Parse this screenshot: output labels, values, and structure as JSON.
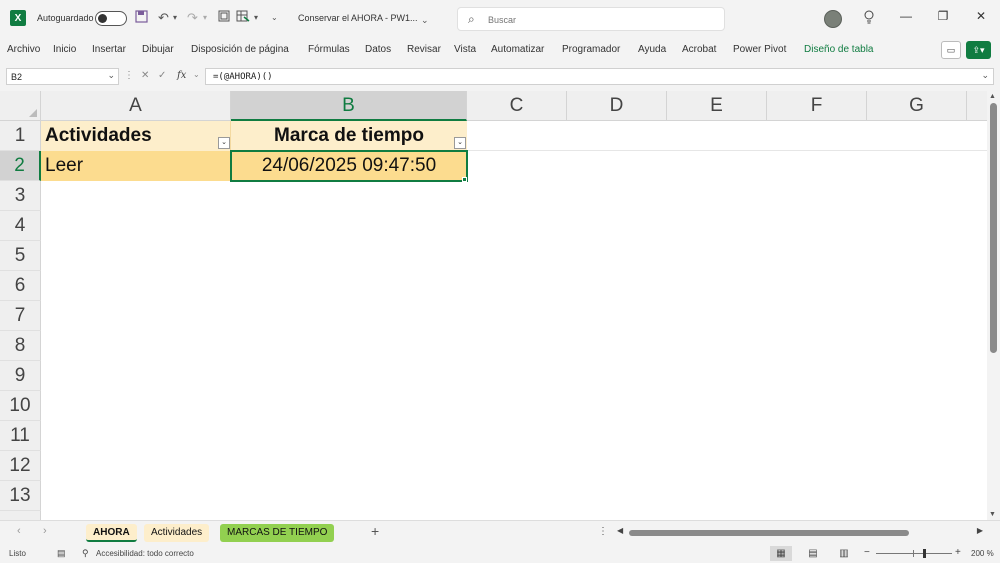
{
  "titlebar": {
    "autosave_label": "Autoguardado",
    "document_title": "Conservar el AHORA - PW1...",
    "search_placeholder": "Buscar"
  },
  "ribbon": {
    "tabs": [
      "Archivo",
      "Inicio",
      "Insertar",
      "Dibujar",
      "Disposición de página",
      "Fórmulas",
      "Datos",
      "Revisar",
      "Vista",
      "Automatizar",
      "Programador",
      "Ayuda",
      "Acrobat",
      "Power Pivot",
      "Diseño de tabla"
    ]
  },
  "formula_bar": {
    "name_box": "B2",
    "formula": "=(@AHORA)()"
  },
  "grid": {
    "columns": [
      "A",
      "B",
      "C",
      "D",
      "E",
      "F",
      "G"
    ],
    "rows": [
      "1",
      "2",
      "3",
      "4",
      "5",
      "6",
      "7",
      "8",
      "9",
      "10",
      "11",
      "12",
      "13"
    ],
    "selected_column": "B",
    "selected_row": "2",
    "table": {
      "headers": [
        "Actividades",
        "Marca de tiempo"
      ],
      "row1": [
        "Leer",
        "24/06/2025 09:47:50"
      ]
    }
  },
  "sheets": {
    "tabs": [
      "AHORA",
      "Actividades",
      "MARCAS DE TIEMPO"
    ],
    "active": "AHORA"
  },
  "status": {
    "ready": "Listo",
    "accessibility": "Accesibilidad: todo correcto",
    "zoom": "200 %"
  },
  "colors": {
    "accent": "#107c41",
    "table_header_fill": "#fdeecb",
    "table_row_fill": "#fcdc8f",
    "tab_green": "#92d050"
  },
  "icons": [
    "excel-logo-icon",
    "save-icon",
    "undo-icon",
    "redo-icon",
    "search-icon",
    "lightbulb-icon",
    "minimize-icon",
    "restore-icon",
    "close-icon",
    "comment-icon",
    "share-icon",
    "fx-icon",
    "filter-dropdown-icon"
  ]
}
